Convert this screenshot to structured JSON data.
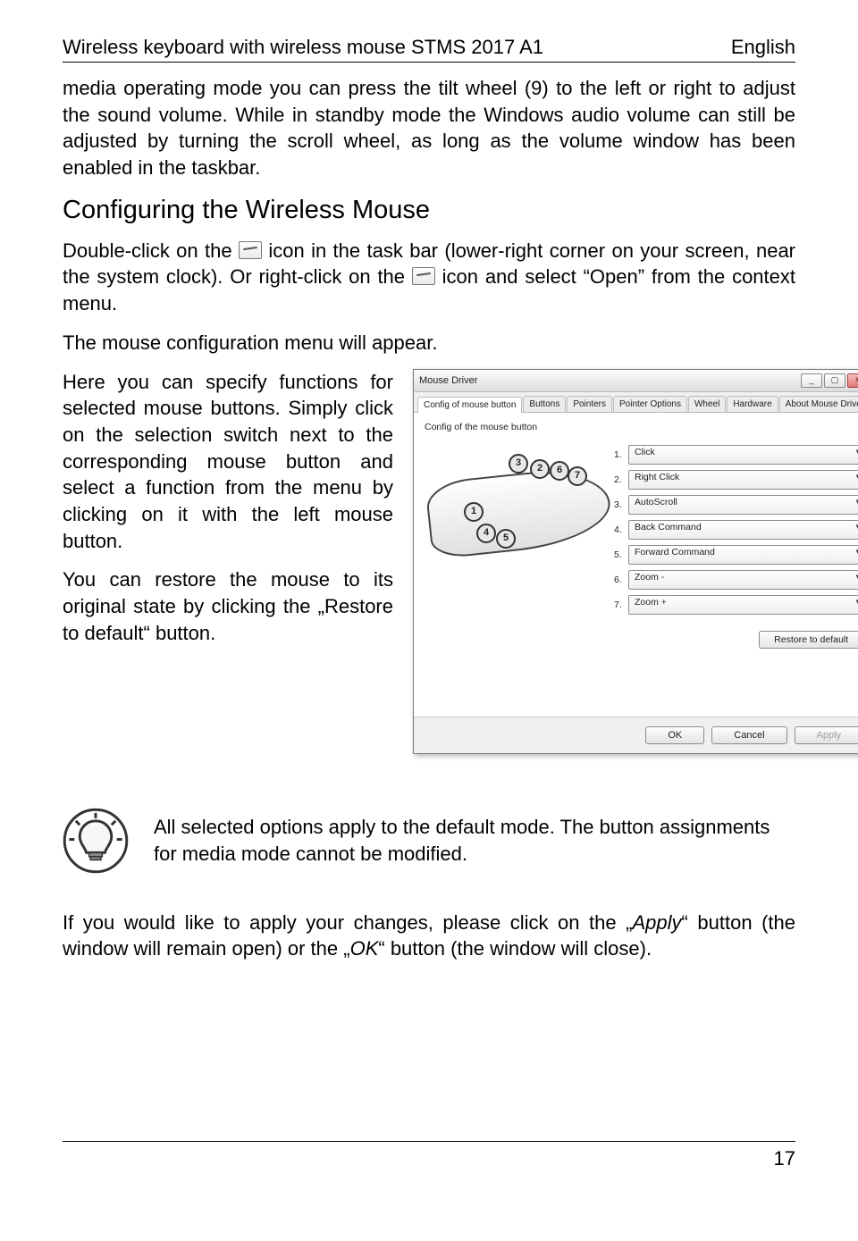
{
  "header": {
    "left": "Wireless keyboard with wireless mouse STMS 2017 A1",
    "right": "English"
  },
  "para1": "media operating mode you can press the tilt wheel (9) to the left or right to adjust the sound volume. While in standby mode the Windows audio volume can still be adjusted by turning the scroll wheel, as long as the volume window has been enabled in the taskbar.",
  "heading": "Configuring the Wireless Mouse",
  "para2_a": "Double-click on the ",
  "para2_b": " icon in the task bar (lower-right corner on your screen, near the system clock). Or right-click on the ",
  "para2_c": " icon and select “Open” from the context menu.",
  "para3": "The mouse configuration menu will appear.",
  "para4": "Here you can specify functions for selected mouse buttons. Simply click on the selection switch next to the corresponding mouse button and select a function from the menu by clicking on it with the left mouse button.",
  "para5": "You can restore the mouse to its original state by clicking the „Restore to default“ button.",
  "dialog": {
    "title": "Mouse Driver",
    "tabs": [
      "Config of mouse button",
      "Buttons",
      "Pointers",
      "Pointer Options",
      "Wheel",
      "Hardware",
      "About Mouse Driver"
    ],
    "section": "Config of the mouse button",
    "options": [
      {
        "n": "1.",
        "v": "Click"
      },
      {
        "n": "2.",
        "v": "Right Click"
      },
      {
        "n": "3.",
        "v": "AutoScroll"
      },
      {
        "n": "4.",
        "v": "Back Command"
      },
      {
        "n": "5.",
        "v": "Forward Command"
      },
      {
        "n": "6.",
        "v": "Zoom -"
      },
      {
        "n": "7.",
        "v": "Zoom +"
      }
    ],
    "restore": "Restore to default",
    "ok": "OK",
    "cancel": "Cancel",
    "apply": "Apply"
  },
  "note": "All selected options apply to the default mode. The button assignments for media mode cannot be modified.",
  "para6_a": "If you would like to apply your changes, please click on the „",
  "para6_apply": "Apply",
  "para6_b": "“ button (the window will remain open) or the „",
  "para6_ok": "OK",
  "para6_c": "“ button (the window will close).",
  "pagenum": "17"
}
